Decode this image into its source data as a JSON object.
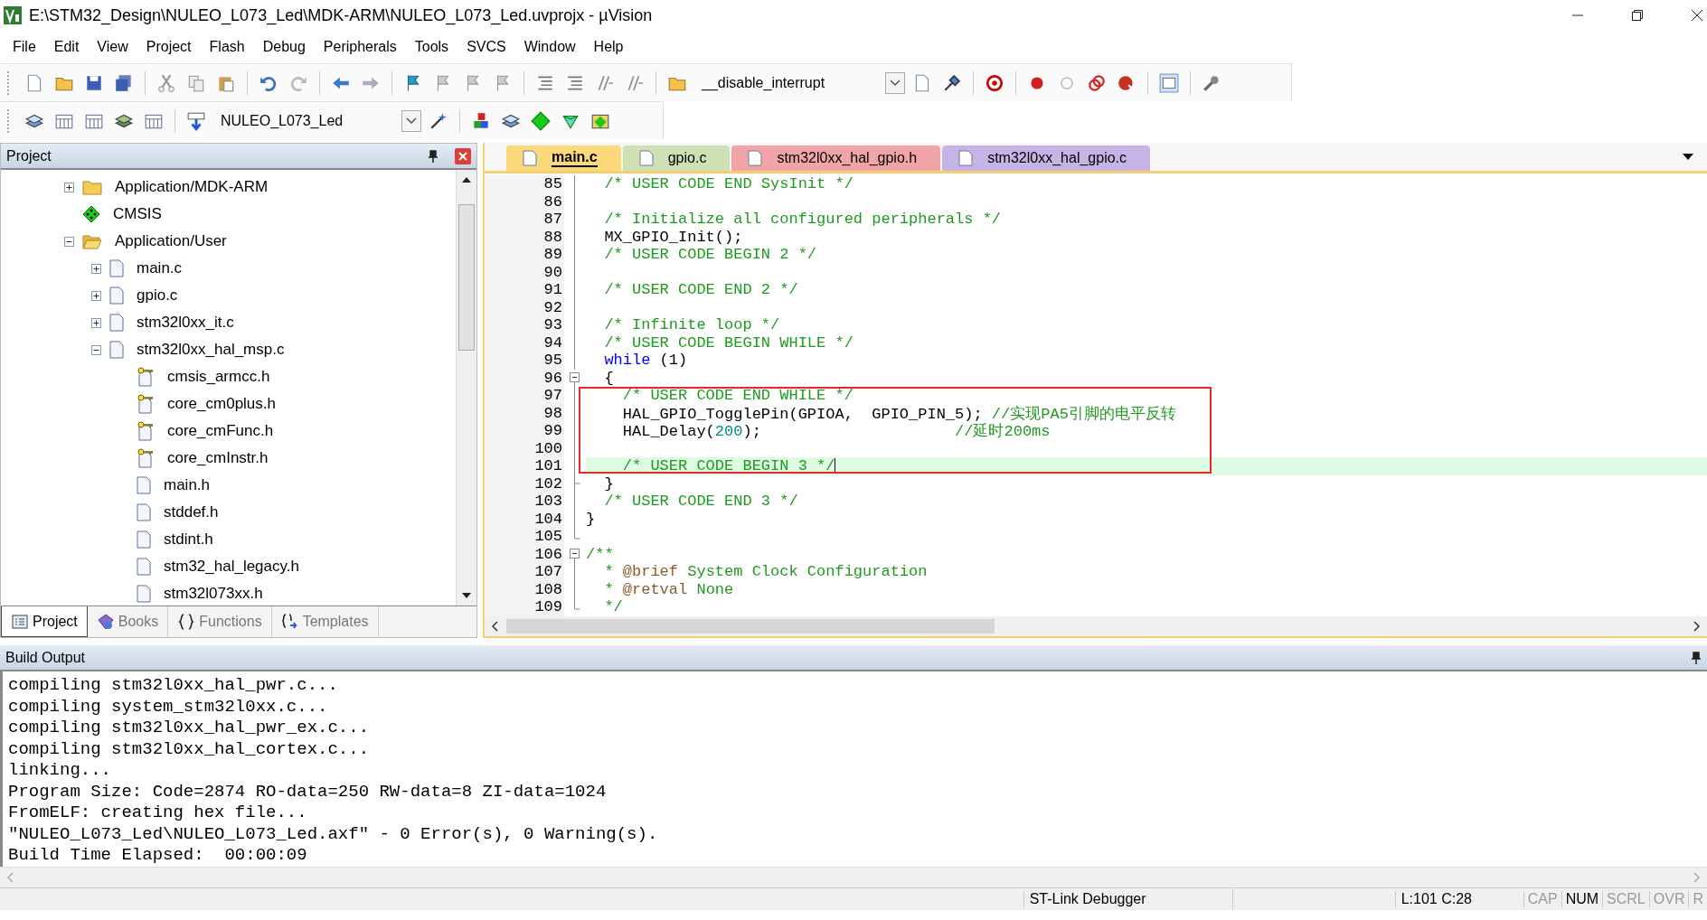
{
  "window": {
    "title": "E:\\STM32_Design\\NULEO_L073_Led\\MDK-ARM\\NULEO_L073_Led.uvprojx - µVision"
  },
  "menu": [
    "File",
    "Edit",
    "View",
    "Project",
    "Flash",
    "Debug",
    "Peripherals",
    "Tools",
    "SVCS",
    "Window",
    "Help"
  ],
  "toolbar": {
    "find_combo": "__disable_interrupt",
    "target_combo": "NULEO_L073_Led"
  },
  "project": {
    "title": "Project",
    "tree": [
      {
        "label": "Application/MDK-ARM",
        "kind": "folder",
        "expanded": false
      },
      {
        "label": "CMSIS",
        "kind": "component"
      },
      {
        "label": "Application/User",
        "kind": "folder_open",
        "expanded": true,
        "children": [
          {
            "label": "main.c",
            "kind": "file",
            "expanded": false
          },
          {
            "label": "gpio.c",
            "kind": "file",
            "expanded": false
          },
          {
            "label": "stm32l0xx_it.c",
            "kind": "file",
            "expanded": false
          },
          {
            "label": "stm32l0xx_hal_msp.c",
            "kind": "file",
            "expanded": true,
            "children": [
              {
                "label": "cmsis_armcc.h",
                "kind": "header_key"
              },
              {
                "label": "core_cm0plus.h",
                "kind": "header_key"
              },
              {
                "label": "core_cmFunc.h",
                "kind": "header_key"
              },
              {
                "label": "core_cmInstr.h",
                "kind": "header_key"
              },
              {
                "label": "main.h",
                "kind": "header"
              },
              {
                "label": "stddef.h",
                "kind": "header"
              },
              {
                "label": "stdint.h",
                "kind": "header"
              },
              {
                "label": "stm32_hal_legacy.h",
                "kind": "header"
              },
              {
                "label": "stm32l073xx.h",
                "kind": "header"
              }
            ]
          }
        ]
      }
    ],
    "tabs": [
      {
        "label": "Project",
        "kind": "project",
        "selected": true
      },
      {
        "label": "Books",
        "kind": "books",
        "selected": false
      },
      {
        "label": "Functions",
        "kind": "functions",
        "selected": false
      },
      {
        "label": "Templates",
        "kind": "templates",
        "selected": false
      }
    ]
  },
  "editor": {
    "tabs": [
      {
        "label": "main.c",
        "selected": true,
        "color": "#fbd97a"
      },
      {
        "label": "gpio.c",
        "selected": false,
        "color": "#cfe0b4"
      },
      {
        "label": "stm32l0xx_hal_gpio.h",
        "selected": false,
        "color": "#f2a5a8"
      },
      {
        "label": "stm32l0xx_hal_gpio.c",
        "selected": false,
        "color": "#c7b4e6"
      }
    ],
    "lines": [
      {
        "number": "85",
        "kind": "line",
        "current": false,
        "boxed": false,
        "segments": [
          {
            "kind": "comment",
            "text": "  /* USER CODE END SysInit */"
          }
        ]
      },
      {
        "number": "86",
        "kind": "line",
        "current": false,
        "boxed": false
      },
      {
        "number": "87",
        "kind": "line",
        "current": false,
        "boxed": false,
        "segments": [
          {
            "kind": "comment",
            "text": "  /* Initialize all configured peripherals */"
          }
        ]
      },
      {
        "number": "88",
        "kind": "line",
        "current": false,
        "boxed": false,
        "segments": [
          {
            "kind": "code",
            "text": "  MX_GPIO_Init();"
          }
        ]
      },
      {
        "number": "89",
        "kind": "line",
        "current": false,
        "boxed": false,
        "segments": [
          {
            "kind": "comment",
            "text": "  /* USER CODE BEGIN 2 */"
          }
        ]
      },
      {
        "number": "90",
        "kind": "line",
        "current": false,
        "boxed": false
      },
      {
        "number": "91",
        "kind": "line",
        "current": false,
        "boxed": false,
        "segments": [
          {
            "kind": "comment",
            "text": "  /* USER CODE END 2 */"
          }
        ]
      },
      {
        "number": "92",
        "kind": "line",
        "current": false,
        "boxed": false
      },
      {
        "number": "93",
        "kind": "line",
        "current": false,
        "boxed": false,
        "segments": [
          {
            "kind": "comment",
            "text": "  /* Infinite loop */"
          }
        ]
      },
      {
        "number": "94",
        "kind": "line",
        "current": false,
        "boxed": false,
        "segments": [
          {
            "kind": "comment",
            "text": "  /* USER CODE BEGIN WHILE */"
          }
        ]
      },
      {
        "number": "95",
        "kind": "line",
        "current": false,
        "boxed": false,
        "segments": [
          {
            "kind": "keyword",
            "text": "  while"
          },
          {
            "kind": "code",
            "text": " (1)"
          }
        ]
      },
      {
        "number": "96",
        "kind": "fold_start",
        "current": false,
        "boxed": false,
        "segments": [
          {
            "kind": "code",
            "text": "  {"
          }
        ]
      },
      {
        "number": "97",
        "kind": "line",
        "current": false,
        "boxed": true,
        "segments": [
          {
            "kind": "comment",
            "text": "    /* USER CODE END WHILE */"
          }
        ]
      },
      {
        "number": "98",
        "kind": "line",
        "current": false,
        "boxed": true,
        "segments": [
          {
            "kind": "code",
            "text": "    HAL_GPIO_TogglePin(GPIOA,  GPIO_PIN_5);"
          },
          {
            "kind": "comment",
            "text": " //实现PA5引脚的电平反转"
          }
        ]
      },
      {
        "number": "99",
        "kind": "line",
        "current": false,
        "boxed": true,
        "segments": [
          {
            "kind": "code",
            "text": "    HAL_Delay("
          },
          {
            "kind": "number",
            "text": "200"
          },
          {
            "kind": "code",
            "text": ");"
          },
          {
            "kind": "comment",
            "text": "                     //延时200ms"
          }
        ]
      },
      {
        "number": "100",
        "kind": "line",
        "current": false,
        "boxed": true
      },
      {
        "number": "101",
        "kind": "line",
        "current": true,
        "boxed": true,
        "segments": [
          {
            "kind": "comment",
            "text": "    /* USER CODE BEGIN 3 */"
          }
        ]
      },
      {
        "number": "102",
        "kind": "block_end",
        "current": false,
        "boxed": false,
        "segments": [
          {
            "kind": "code",
            "text": "  }"
          }
        ]
      },
      {
        "number": "103",
        "kind": "line",
        "current": false,
        "boxed": false,
        "segments": [
          {
            "kind": "comment",
            "text": "  /* USER CODE END 3 */"
          }
        ]
      },
      {
        "number": "104",
        "kind": "line",
        "current": false,
        "boxed": false,
        "segments": [
          {
            "kind": "code",
            "text": "}"
          }
        ]
      },
      {
        "number": "105",
        "kind": "fold_end",
        "current": false,
        "boxed": false
      },
      {
        "number": "106",
        "kind": "fold_start",
        "current": false,
        "boxed": false,
        "segments": [
          {
            "kind": "comment",
            "text": "/**"
          }
        ]
      },
      {
        "number": "107",
        "kind": "line",
        "current": false,
        "boxed": false,
        "segments": [
          {
            "kind": "comment",
            "text": "  * "
          },
          {
            "kind": "doc_tag",
            "text": "@brief"
          },
          {
            "kind": "comment",
            "text": " System Clock Configuration"
          }
        ]
      },
      {
        "number": "108",
        "kind": "line",
        "current": false,
        "boxed": false,
        "segments": [
          {
            "kind": "comment",
            "text": "  * "
          },
          {
            "kind": "doc_tag",
            "text": "@retval"
          },
          {
            "kind": "comment",
            "text": " None"
          }
        ]
      },
      {
        "number": "109",
        "kind": "fold_end",
        "current": false,
        "boxed": false,
        "segments": [
          {
            "kind": "comment",
            "text": "  */"
          }
        ]
      }
    ]
  },
  "build_output": {
    "title": "Build Output",
    "lines": [
      "compiling stm32l0xx_hal_pwr.c...",
      "compiling system_stm32l0xx.c...",
      "compiling stm32l0xx_hal_pwr_ex.c...",
      "compiling stm32l0xx_hal_cortex.c...",
      "linking...",
      "Program Size: Code=2874 RO-data=250 RW-data=8 ZI-data=1024",
      "FromELF: creating hex file...",
      "\"NULEO_L073_Led\\NULEO_L073_Led.axf\" - 0 Error(s), 0 Warning(s).",
      "Build Time Elapsed:  00:00:09"
    ]
  },
  "status_bar": {
    "debugger": "ST-Link Debugger",
    "position": "L:101 C:28",
    "indicators": [
      {
        "label": "CAP",
        "on": false
      },
      {
        "label": "NUM",
        "on": true
      },
      {
        "label": "SCRL",
        "on": false
      },
      {
        "label": "OVR",
        "on": false
      },
      {
        "label": "R",
        "on": false
      }
    ]
  }
}
